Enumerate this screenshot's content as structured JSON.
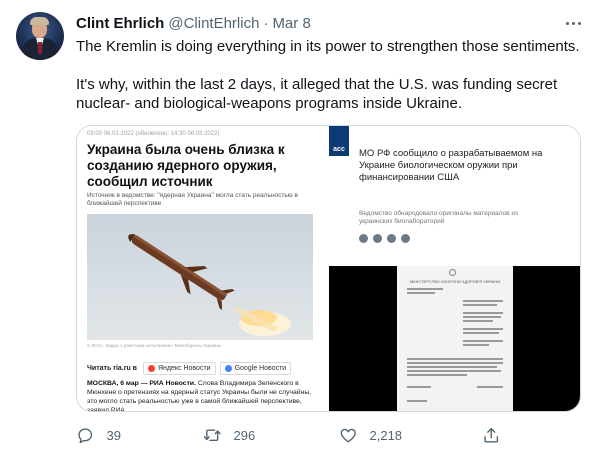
{
  "tweet": {
    "author_name": "Clint Ehrlich",
    "author_handle": "@ClintEhrlich",
    "separator": "·",
    "date": "Mar 8",
    "text_line_1": "The Kremlin is doing everything in its power to strengthen those sentiments.",
    "text_line_2": "It's why, within the last 2 days, it alleged that the U.S. was funding secret",
    "text_line_3": "nuclear- and biological-weapons programs inside Ukraine."
  },
  "media": {
    "left": {
      "meta": "09:00 06.03.2022 (обновлено: 14:30 06.03.2022)",
      "headline": "Украина была очень близка к созданию ядерного оружия, сообщил источник",
      "subheadline": "Источник в ведомстве: \"ядерная Украина\" могла стать реальностью в ближайшей перспективе",
      "photo_caption": "© Фото : Кадры с ракетным испытанием / Минобороны Украины",
      "read_label": "Читать ria.ru в",
      "yandex_label": "Яндекс Новости",
      "google_label": "Google Новости",
      "body_bold": "МОСКВА, 6 мар — РИА Новости.",
      "body_text": "Слова Владимира Зеленского в Мюнхене о претензиях на ядерный статус Украины были не случайны, это могло стать реальностью уже в самой ближайшей перспективе, заявил РИА"
    },
    "right": {
      "logo": "acc",
      "headline": "МО РФ сообщило о разрабатываемом на Украине биологическом оружии при финансировании США",
      "subheadline": "Ведомство обнародовало оригиналы материалов из украинских биолабораторий",
      "document_title": "МІНІСТЕРСТВО ОХОРОНИ ЗДОРОВ'Я УКРАЇНИ"
    }
  },
  "actions": {
    "reply_count": "39",
    "retweet_count": "296",
    "like_count": "2,218"
  },
  "colors": {
    "secondary_text": "#536471",
    "primary_text": "#0f1419",
    "border": "#cfd9de"
  },
  "icons": {
    "reply": "reply-icon",
    "retweet": "retweet-icon",
    "like": "heart-icon",
    "share": "share-icon",
    "more": "more-icon"
  }
}
